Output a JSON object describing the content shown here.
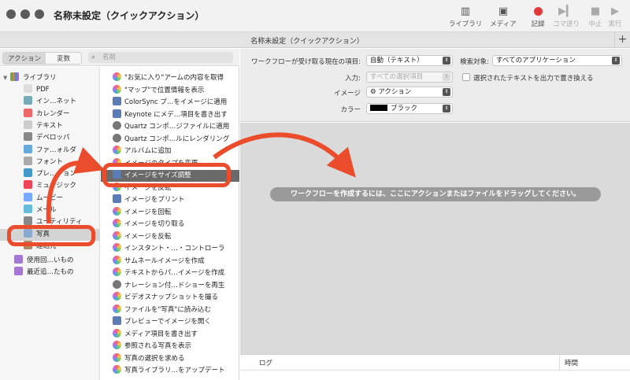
{
  "window": {
    "title": "名称未設定（クイックアクション）",
    "tab_title": "名称未設定（クイックアクション）"
  },
  "toolbar": [
    {
      "label": "ライブラリ",
      "icon": "sidebar-icon"
    },
    {
      "label": "メディア",
      "icon": "media-icon"
    },
    {
      "label": "記録",
      "icon": "record-icon"
    },
    {
      "label": "コマ送り",
      "icon": "step-icon"
    },
    {
      "label": "中止",
      "icon": "stop-icon"
    },
    {
      "label": "実行",
      "icon": "play-icon"
    }
  ],
  "left_header": {
    "tab_actions": "アクション",
    "tab_variables": "変数",
    "search_placeholder": "名前"
  },
  "library": {
    "root": "ライブラリ",
    "items": [
      "PDF",
      "インターネット",
      "カレンダー",
      "テキスト",
      "デベロッパ",
      "ファイルとフォルダ",
      "フォント",
      "プレゼンテーション",
      "ミュージック",
      "ムービー",
      "メール",
      "ユーティリティ",
      "写真",
      "連絡先"
    ],
    "items_display": [
      "PDF",
      "イン…ネット",
      "カレンダー",
      "テキスト",
      "デベロッパ",
      "ファ…ォルダ",
      "フォント",
      "プレ…ション",
      "ミュージック",
      "ムービー",
      "メール",
      "ユーティリティ",
      "写真",
      "連絡先"
    ],
    "smart": [
      "使用回…いもの",
      "最近追…たもの"
    ],
    "selected": "写真"
  },
  "actions": [
    "\"お気に入り\"アームの内容を取得",
    "\"マップ\"で位置情報を表示",
    "ColorSync プ…をイメージに適用",
    "Keynote にメデ…項目を書き出す",
    "Quartz コンポ…ジファイルに適用",
    "Quartz コンポ…ルにレンダリング",
    "アルバムに追加",
    "イメージのタイプを変更",
    "イメージをサイズ調整",
    "イメージを反転",
    "イメージをプリント",
    "イメージを回転",
    "イメージを切り取る",
    "イメージを反転",
    "インスタント・…・コントローラ",
    "サムネールイメージを作成",
    "テキストからパ…イメージを作成",
    "ナレーション付…ドショーを再生",
    "ビデオスナップショットを撮る",
    "ファイルを\"写真\"に読み込む",
    "プレビューでイメージを開く",
    "メディア項目を書き出す",
    "参照される写真を表示",
    "写真の選択を求める",
    "写真ライブラリ…をアップデート"
  ],
  "selected_action": "イメージをサイズ調整",
  "options": {
    "input_label": "ワークフローが受け取る現在の項目:",
    "input_value": "自動（テキスト）",
    "search_label": "検索対象:",
    "search_value": "すべてのアプリケーション",
    "entry_label": "入力:",
    "entry_value": "すべての選択項目",
    "replace_label": "選択されたテキストを出力で置き換える",
    "image_label": "イメージ",
    "image_value": "⚙ アクション",
    "color_label": "カラー",
    "color_value": "ブラック"
  },
  "canvas_hint": "ワークフローを作成するには、ここにアクションまたはファイルをドラッグしてください。",
  "log": {
    "col_log": "ログ",
    "col_time": "時間"
  },
  "colors": {
    "annotation": "#ea4c2c",
    "record": "#e03a3a",
    "selection": "#6a6a6a"
  }
}
